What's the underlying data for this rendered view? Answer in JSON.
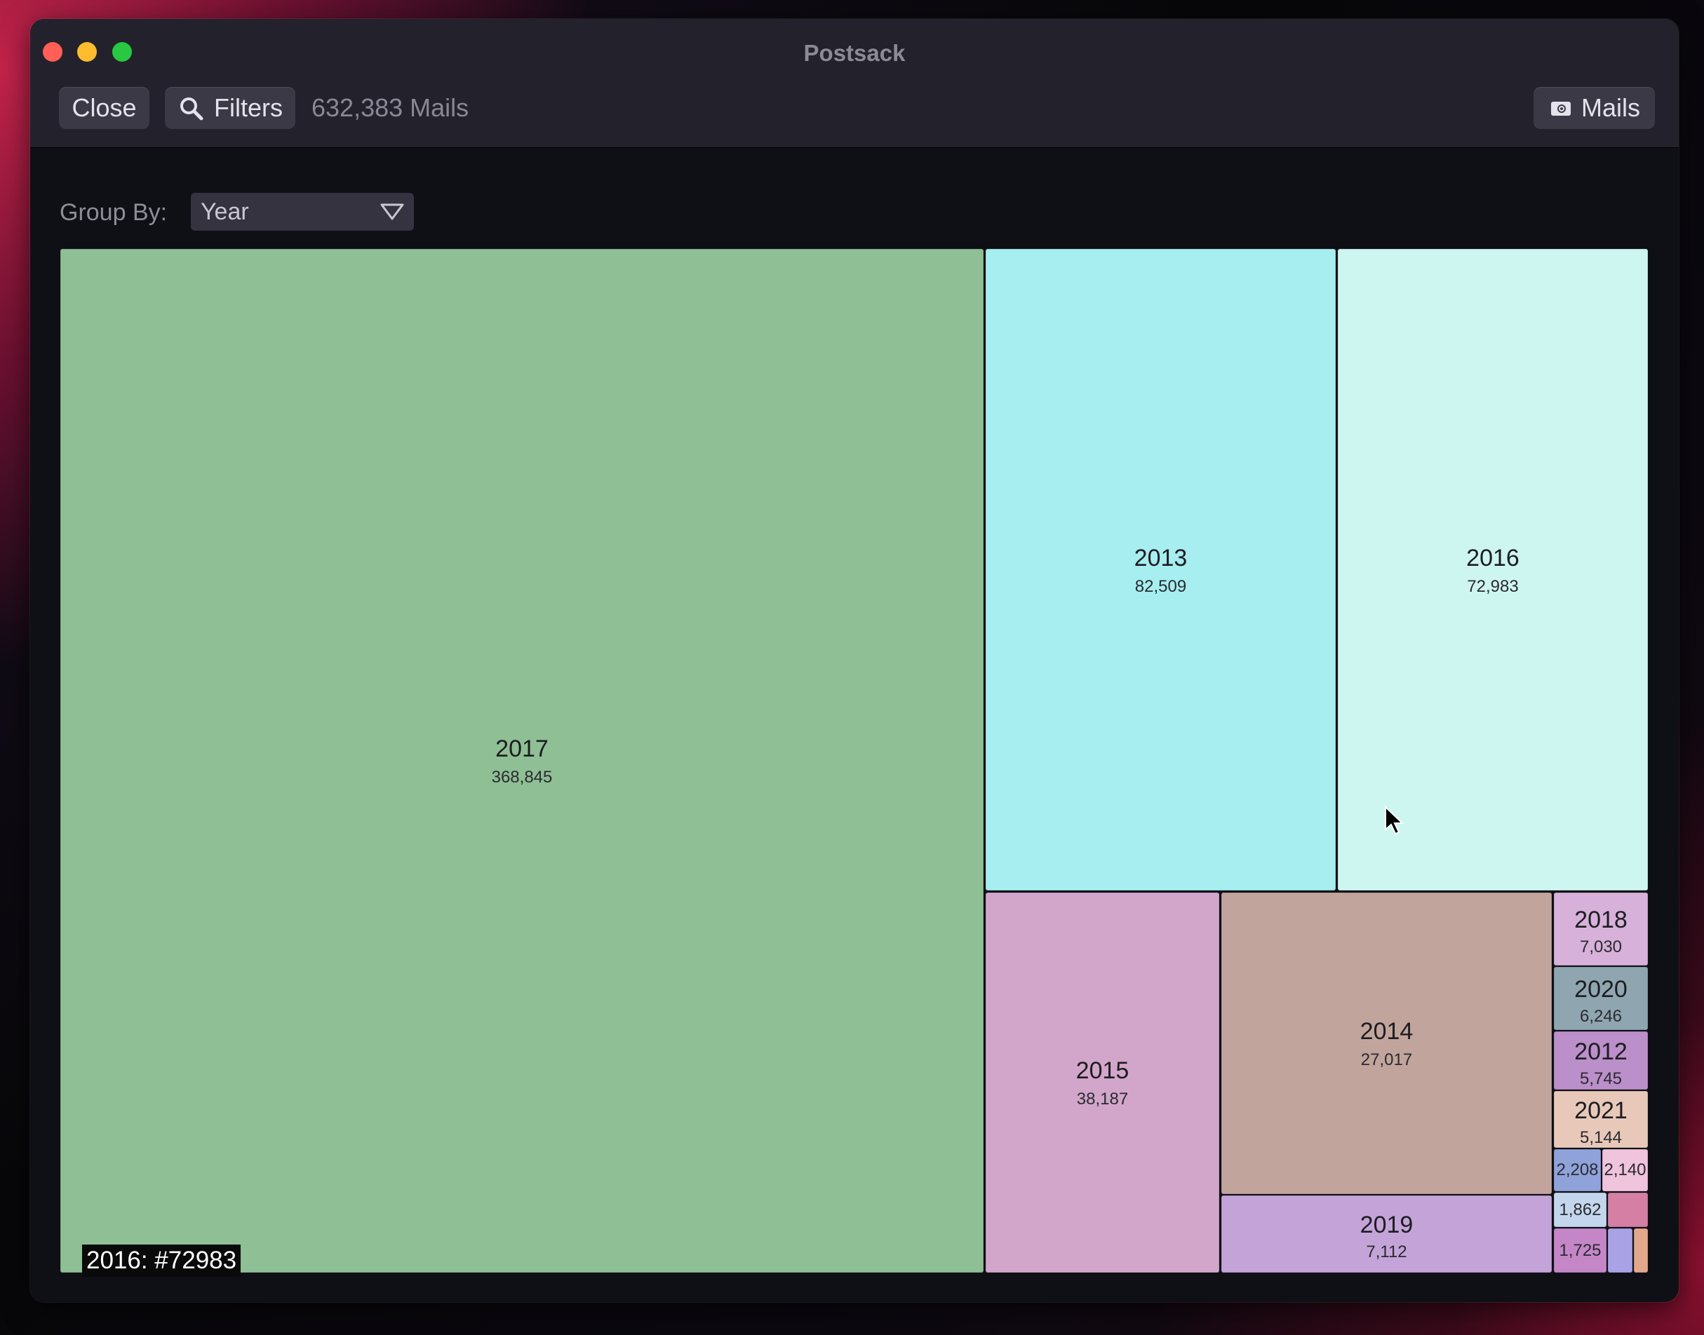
{
  "window": {
    "title": "Postsack"
  },
  "toolbar": {
    "close_label": "Close",
    "filters_label": "Filters",
    "mail_count": "632,383 Mails",
    "mails_label": "Mails"
  },
  "group_by": {
    "label": "Group By:",
    "selected": "Year"
  },
  "treemap": {
    "tiles": [
      {
        "year": "2017",
        "count": "368,845",
        "color": "#8fbf94"
      },
      {
        "year": "2013",
        "count": "82,509",
        "color": "#a6eef0"
      },
      {
        "year": "2016",
        "count": "72,983",
        "color": "#cdf6f0"
      },
      {
        "year": "2015",
        "count": "38,187",
        "color": "#d2a6ca"
      },
      {
        "year": "2014",
        "count": "27,017",
        "color": "#c1a59c"
      },
      {
        "year": "2019",
        "count": "7,112",
        "color": "#c4a4d8"
      },
      {
        "year": "2018",
        "count": "7,030",
        "color": "#d7b1d9"
      },
      {
        "year": "2020",
        "count": "6,246",
        "color": "#8fa6b0"
      },
      {
        "year": "2012",
        "count": "5,745",
        "color": "#bb8fc9"
      },
      {
        "year": "2021",
        "count": "5,144",
        "color": "#e8c9b9"
      },
      {
        "count": "2,208",
        "color": "#8fa2d9"
      },
      {
        "count": "2,140",
        "color": "#efc4dc"
      },
      {
        "count": "1,862",
        "color": "#c3d6ec"
      },
      {
        "color": "#d47fa3"
      },
      {
        "count": "1,725",
        "color": "#c586c8"
      },
      {
        "color": "#a9a3e6"
      },
      {
        "color": "#e1a88c"
      }
    ],
    "tooltip": "2016: #72983"
  }
}
